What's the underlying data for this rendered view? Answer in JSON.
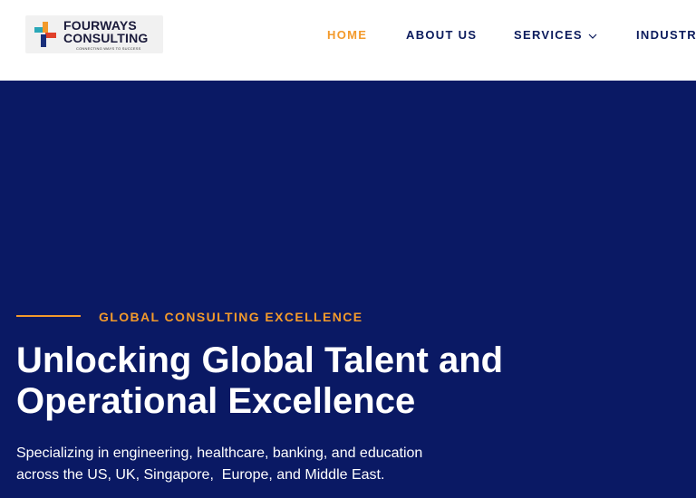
{
  "logo": {
    "line1": "FOURWAYS",
    "line2": "CONSULTING",
    "tagline": "CONNECTING WAYS TO SUCCESS",
    "icon": "cross-logo-icon",
    "colors": {
      "teal": "#2aa8b8",
      "orange": "#f39a2b",
      "red": "#e0402a",
      "navy": "#1a2f7a"
    }
  },
  "nav": {
    "home": "HOME",
    "about": "ABOUT US",
    "services": "SERVICES",
    "industry": "INDUSTRY",
    "services_icon": "chevron-down-icon"
  },
  "hero": {
    "eyebrow": "GLOBAL CONSULTING EXCELLENCE",
    "headline_line1": "Unlocking Global Talent and",
    "headline_line2": "Operational Excellence",
    "subtext_line1": "Specializing in engineering, healthcare, banking, and education",
    "subtext_line2": "across the US, UK, Singapore,  Europe, and Middle East."
  },
  "colors": {
    "accent": "#f39a2b",
    "nav_text": "#0a1a5c",
    "hero_bg": "#0a1964",
    "hero_text": "#ffffff"
  }
}
